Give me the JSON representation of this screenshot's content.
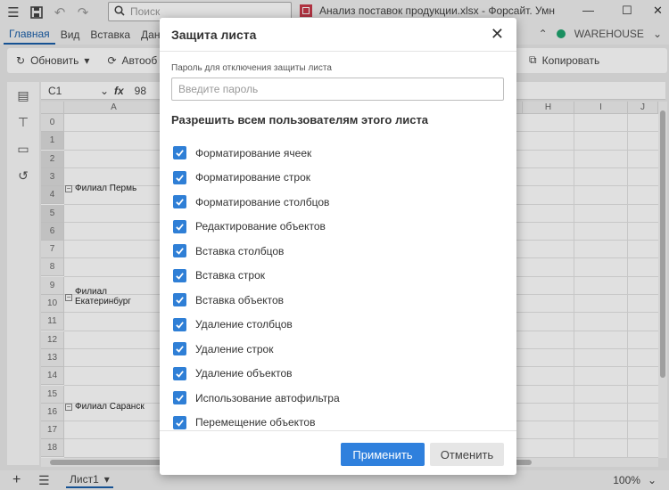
{
  "titlebar": {
    "search_placeholder": "Поиск",
    "doc_title": "Анализ поставок продукции.xlsx - Форсайт. Умн",
    "icons": [
      "hamburger-icon",
      "save-icon",
      "undo-icon",
      "redo-icon",
      "search-icon",
      "spreadsheet-icon",
      "minimize-icon",
      "maximize-icon",
      "close-icon"
    ]
  },
  "menu": {
    "items": [
      "Главная",
      "Вид",
      "Вставка",
      "Дан"
    ],
    "active": "Главная",
    "workspace": "WAREHOUSE"
  },
  "toolbar": {
    "refresh_label": "Обновить",
    "auto_label": "Автооб",
    "copy_label": "Копировать"
  },
  "formula": {
    "cell_ref": "C1",
    "fx": "fx",
    "value": "98"
  },
  "grid": {
    "columns": [
      "A",
      "H",
      "I",
      "J"
    ],
    "rows": [
      "0",
      "1",
      "2",
      "3",
      "4",
      "5",
      "6",
      "7",
      "8",
      "9",
      "10",
      "11",
      "12",
      "13",
      "14",
      "15",
      "16",
      "17",
      "18"
    ],
    "groups": [
      {
        "label": "Филиал Пермь"
      },
      {
        "label": "Филиал Екатеринбург"
      },
      {
        "label": "Филиал Саранск"
      }
    ]
  },
  "statusbar": {
    "sheet_name": "Лист1",
    "zoom": "100%"
  },
  "dialog": {
    "title": "Защита листа",
    "password_label": "Пароль для отключения защиты листа",
    "password_placeholder": "Введите пароль",
    "permissions_heading": "Разрешить всем пользователям этого листа",
    "permissions": [
      {
        "label": "Форматирование ячеек",
        "checked": true
      },
      {
        "label": "Форматирование строк",
        "checked": true
      },
      {
        "label": "Форматирование столбцов",
        "checked": true
      },
      {
        "label": "Редактирование объектов",
        "checked": true
      },
      {
        "label": "Вставка столбцов",
        "checked": true
      },
      {
        "label": "Вставка строк",
        "checked": true
      },
      {
        "label": "Вставка объектов",
        "checked": true
      },
      {
        "label": "Удаление столбцов",
        "checked": true
      },
      {
        "label": "Удаление строк",
        "checked": true
      },
      {
        "label": "Удаление объектов",
        "checked": true
      },
      {
        "label": "Использование автофильтра",
        "checked": true
      },
      {
        "label": "Перемещение объектов",
        "checked": true
      }
    ],
    "apply_label": "Применить",
    "cancel_label": "Отменить"
  },
  "colors": {
    "accent": "#2f80dd",
    "active_tab": "#1a5ea8",
    "status_dot": "#1ea36e"
  }
}
